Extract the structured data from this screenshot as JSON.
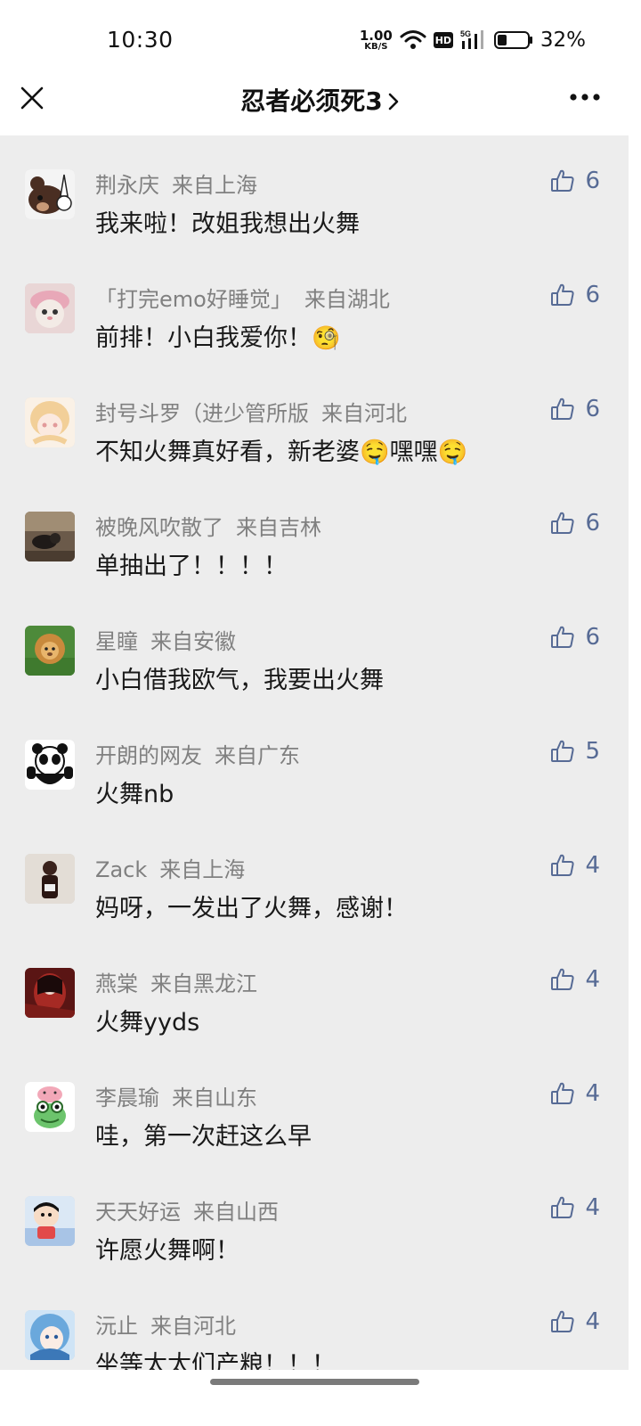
{
  "status_bar": {
    "time": "10:30",
    "net_speed_value": "1.00",
    "net_speed_unit": "KB/S",
    "hd_label": "HD",
    "signal_label": "5G",
    "battery_percent": "32%",
    "battery_level": 0.32
  },
  "nav": {
    "title": "忍者必须死3"
  },
  "colors": {
    "list_background": "#ededed",
    "like_color": "#576b95",
    "name_color": "#808080"
  },
  "comments": [
    {
      "name": "荆永庆",
      "location": "来自上海",
      "text": "我来啦！改姐我想出火舞",
      "likes": "6",
      "avatar": "bear"
    },
    {
      "name": "「打完emo好睡觉」",
      "location": "来自湖北",
      "text": "前排！小白我爱你！",
      "emoji": "🧐",
      "likes": "6",
      "avatar": "cat"
    },
    {
      "name": "封号斗罗（进少管所版",
      "location": "来自河北",
      "text": "不知火舞真好看，新老婆🤤嘿嘿🤤",
      "likes": "6",
      "avatar": "anime-girl"
    },
    {
      "name": "被晚风吹散了",
      "location": "来自吉林",
      "text": "单抽出了！！！！",
      "likes": "6",
      "avatar": "room"
    },
    {
      "name": "星瞳",
      "location": "来自安徽",
      "text": "小白借我欧气，我要出火舞",
      "likes": "6",
      "avatar": "lion"
    },
    {
      "name": "开朗的网友",
      "location": "来自广东",
      "text": "火舞nb",
      "likes": "5",
      "avatar": "panda"
    },
    {
      "name": "Zack",
      "location": "来自上海",
      "text": "妈呀，一发出了火舞，感谢！",
      "likes": "4",
      "avatar": "figure"
    },
    {
      "name": "燕棠",
      "location": "来自黑龙江",
      "text": "火舞yyds",
      "likes": "4",
      "avatar": "red-art"
    },
    {
      "name": "李晨瑜",
      "location": "来自山东",
      "text": "哇，第一次赶这么早",
      "likes": "4",
      "avatar": "frog"
    },
    {
      "name": "天天好运",
      "location": "来自山西",
      "text": "许愿火舞啊！",
      "likes": "4",
      "avatar": "cartoon-boy"
    },
    {
      "name": "沅止",
      "location": "来自河北",
      "text": "坐等太太们产粮！！！",
      "likes": "4",
      "avatar": "blue-anime"
    }
  ]
}
